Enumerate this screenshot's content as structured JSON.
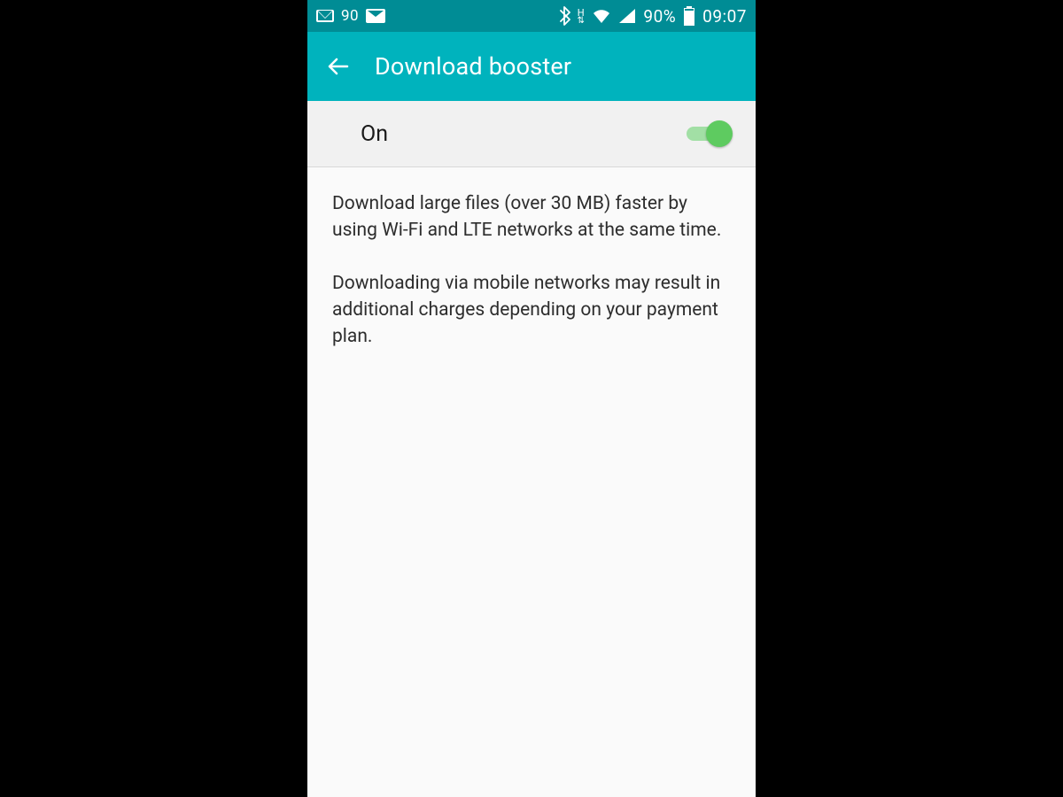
{
  "status_bar": {
    "notification_count": "90",
    "battery_percent": "90%",
    "clock": "09:07",
    "network_indicator": "H"
  },
  "app_bar": {
    "title": "Download booster"
  },
  "toggle": {
    "label": "On",
    "enabled": true
  },
  "description": {
    "p1": "Download large files (over 30 MB) faster by using Wi-Fi and LTE networks at the same time.",
    "p2": "Downloading via mobile networks may result in additional charges depending on your payment plan."
  },
  "colors": {
    "status_bar_bg": "#008c95",
    "app_bar_bg": "#00b3bd",
    "switch_on": "#5ecb60"
  }
}
